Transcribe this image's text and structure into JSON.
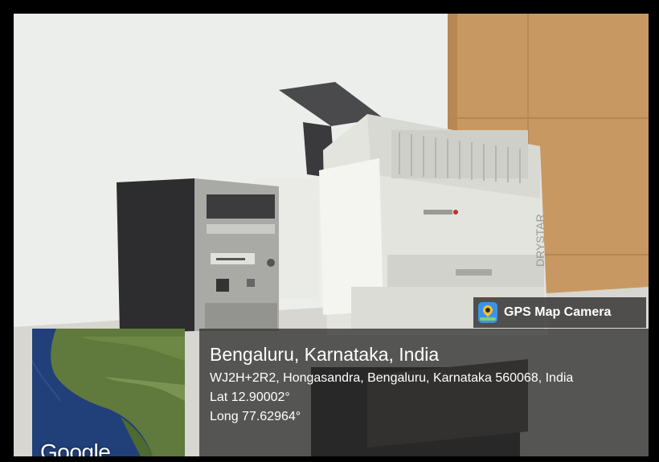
{
  "overlay": {
    "badge_label": "GPS Map Camera",
    "badge_icon": "gps-map-camera-logo",
    "location_title": "Bengaluru, Karnataka, India",
    "address": "WJ2H+2R2, Hongasandra, Bengaluru, Karnataka 560068, India",
    "latitude": "Lat 12.90002°",
    "longitude": "Long 77.62964°",
    "map_watermark": "Google"
  },
  "scene": {
    "printer_brand_text": "DRYSTAR",
    "colors": {
      "wall": "#e8e9e6",
      "wood_panel": "#c99a63",
      "printer_body": "#e6e6e2",
      "pc_case": "#2e2e30",
      "overlay_bg": "#232323",
      "map_ocean": "#23407a",
      "map_land": "#5f7a3c"
    }
  }
}
